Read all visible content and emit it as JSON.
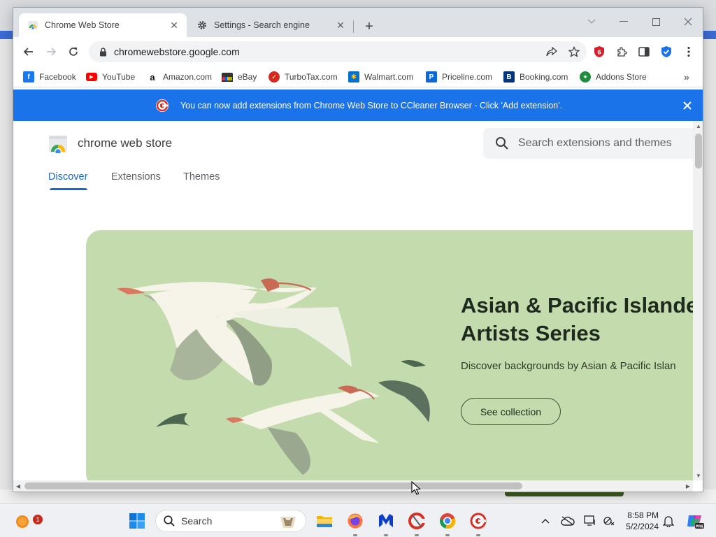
{
  "browser": {
    "tabs": [
      {
        "title": "Chrome Web Store",
        "active": true,
        "favicon": "chrome-web-store-icon"
      },
      {
        "title": "Settings - Search engine",
        "active": false,
        "favicon": "gear-icon"
      }
    ],
    "url": "chromewebstore.google.com",
    "bookmarks": [
      {
        "label": "Facebook",
        "icon": "facebook-icon",
        "color": "#1877f2"
      },
      {
        "label": "YouTube",
        "icon": "youtube-icon",
        "color": "#ff0000"
      },
      {
        "label": "Amazon.com",
        "icon": "amazon-icon",
        "color": "#111111"
      },
      {
        "label": "eBay",
        "icon": "ebay-icon",
        "color": "#333333"
      },
      {
        "label": "TurboTax.com",
        "icon": "turbotax-icon",
        "color": "#d52b1e"
      },
      {
        "label": "Walmart.com",
        "icon": "walmart-icon",
        "color": "#0071ce"
      },
      {
        "label": "Priceline.com",
        "icon": "priceline-icon",
        "color": "#0a6bd8"
      },
      {
        "label": "Booking.com",
        "icon": "booking-icon",
        "color": "#003580"
      },
      {
        "label": "Addons Store",
        "icon": "addons-store-icon",
        "color": "#1e8e3e"
      }
    ],
    "bookmarks_overflow": "»",
    "infobar": {
      "text": "You can now add extensions from Chrome Web Store to CCleaner Browser - Click 'Add extension'.",
      "color": "#1a73e8"
    }
  },
  "store": {
    "name": "chrome web store",
    "search_placeholder": "Search extensions and themes",
    "nav": [
      {
        "label": "Discover",
        "active": true
      },
      {
        "label": "Extensions",
        "active": false
      },
      {
        "label": "Themes",
        "active": false
      }
    ],
    "hero": {
      "title_line1": "Asian & Pacific Islande",
      "title_line2": "Artists Series",
      "subtitle": "Discover backgrounds by Asian & Pacific Islan",
      "button": "See collection",
      "background": "#c4dcad"
    }
  },
  "taskbar": {
    "search_label": "Search",
    "notification_badge": "1",
    "time": "8:58 PM",
    "date": "5/2/2024",
    "apps": [
      "file-explorer-icon",
      "firefox-icon",
      "malwarebytes-icon",
      "ccleaner-icon",
      "chrome-icon",
      "ccleaner-browser-icon"
    ]
  }
}
